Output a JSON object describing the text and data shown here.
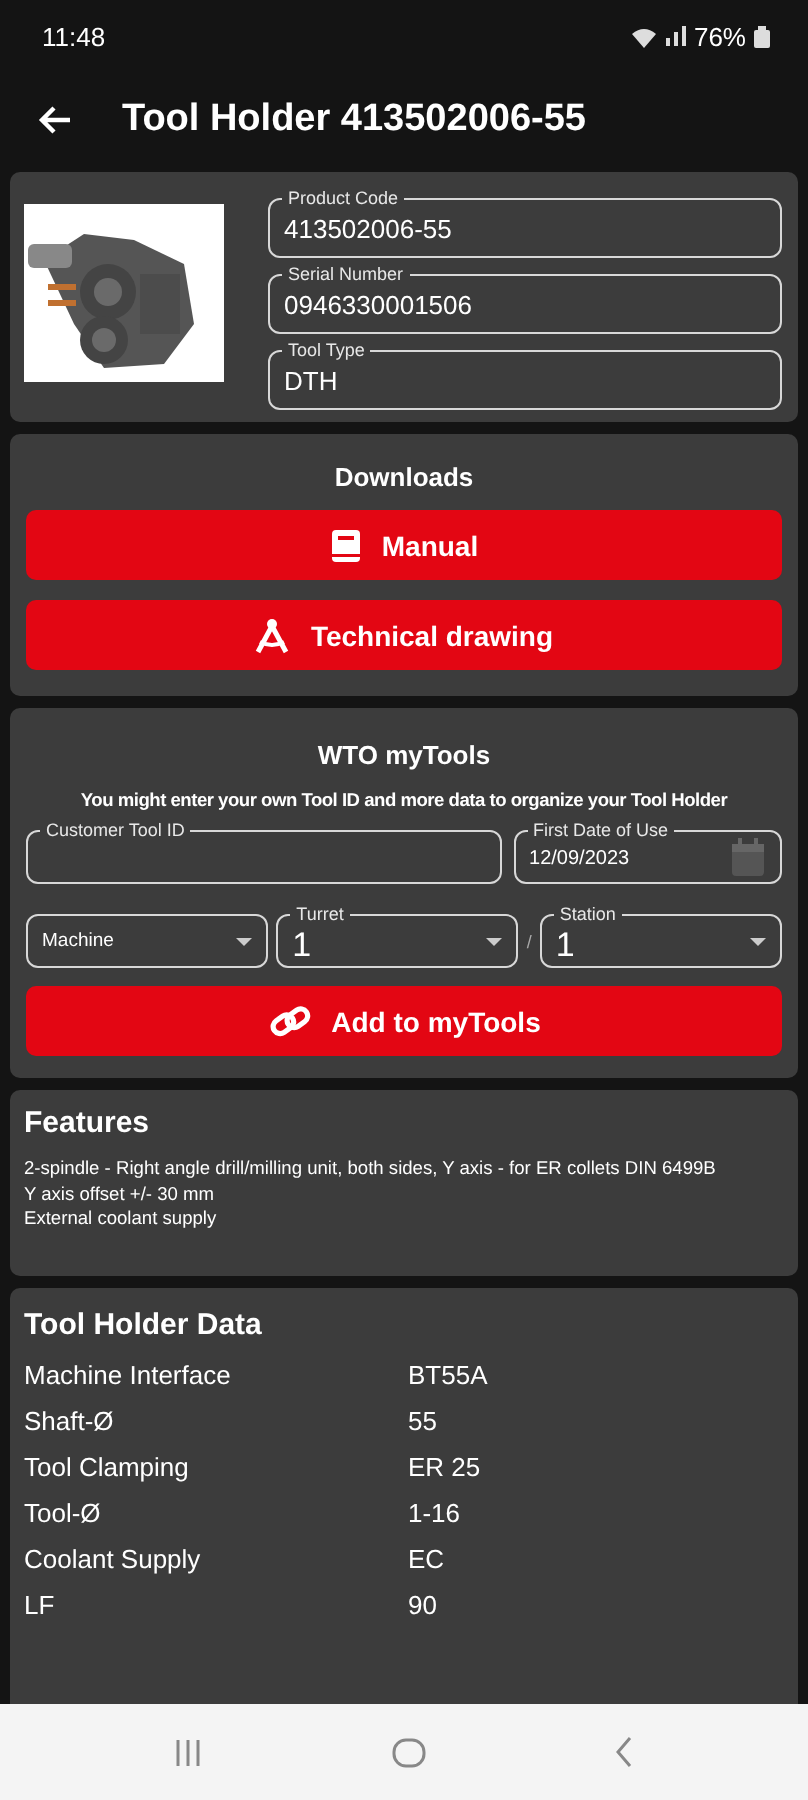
{
  "status_bar": {
    "time": "11:48",
    "battery": "76%"
  },
  "app_bar": {
    "title": "Tool Holder 413502006-55"
  },
  "product": {
    "fields": [
      {
        "label": "Product Code",
        "value": "413502006-55"
      },
      {
        "label": "Serial Number",
        "value": "0946330001506"
      },
      {
        "label": "Tool Type",
        "value": "DTH"
      }
    ]
  },
  "downloads": {
    "title": "Downloads",
    "buttons": [
      {
        "label": "Manual",
        "kind": "manual"
      },
      {
        "label": "Technical drawing",
        "kind": "drawing"
      }
    ]
  },
  "my_tools": {
    "title": "WTO myTools",
    "description": "You might enter your own Tool ID and more data to organize your Tool Holder",
    "customer_tool_id": {
      "label": "Customer Tool ID"
    },
    "first_date_of_use": {
      "label": "First Date of Use",
      "value": "12/09/2023"
    },
    "machine": {
      "placeholder": "Machine"
    },
    "turret": {
      "label": "Turret",
      "value": "1"
    },
    "separator": "/",
    "station": {
      "label": "Station",
      "value": "1"
    },
    "button": {
      "label": "Add to myTools"
    }
  },
  "features": {
    "title": "Features",
    "lines": [
      "2-spindle - Right angle drill/milling unit, both sides, Y axis - for ER collets DIN 6499B",
      "Y axis offset +/- 30 mm",
      "External coolant supply"
    ]
  },
  "tool_holder_data": {
    "title": "Tool Holder Data",
    "rows": [
      {
        "name": "Machine Interface",
        "value": "BT55A"
      },
      {
        "name": "Shaft-Ø",
        "value": "55"
      },
      {
        "name": "Tool Clamping",
        "value": "ER 25"
      },
      {
        "name": "Tool-Ø",
        "value": "1-16"
      },
      {
        "name": "Coolant Supply",
        "value": "EC"
      },
      {
        "name": "LF",
        "value": "90"
      }
    ]
  }
}
